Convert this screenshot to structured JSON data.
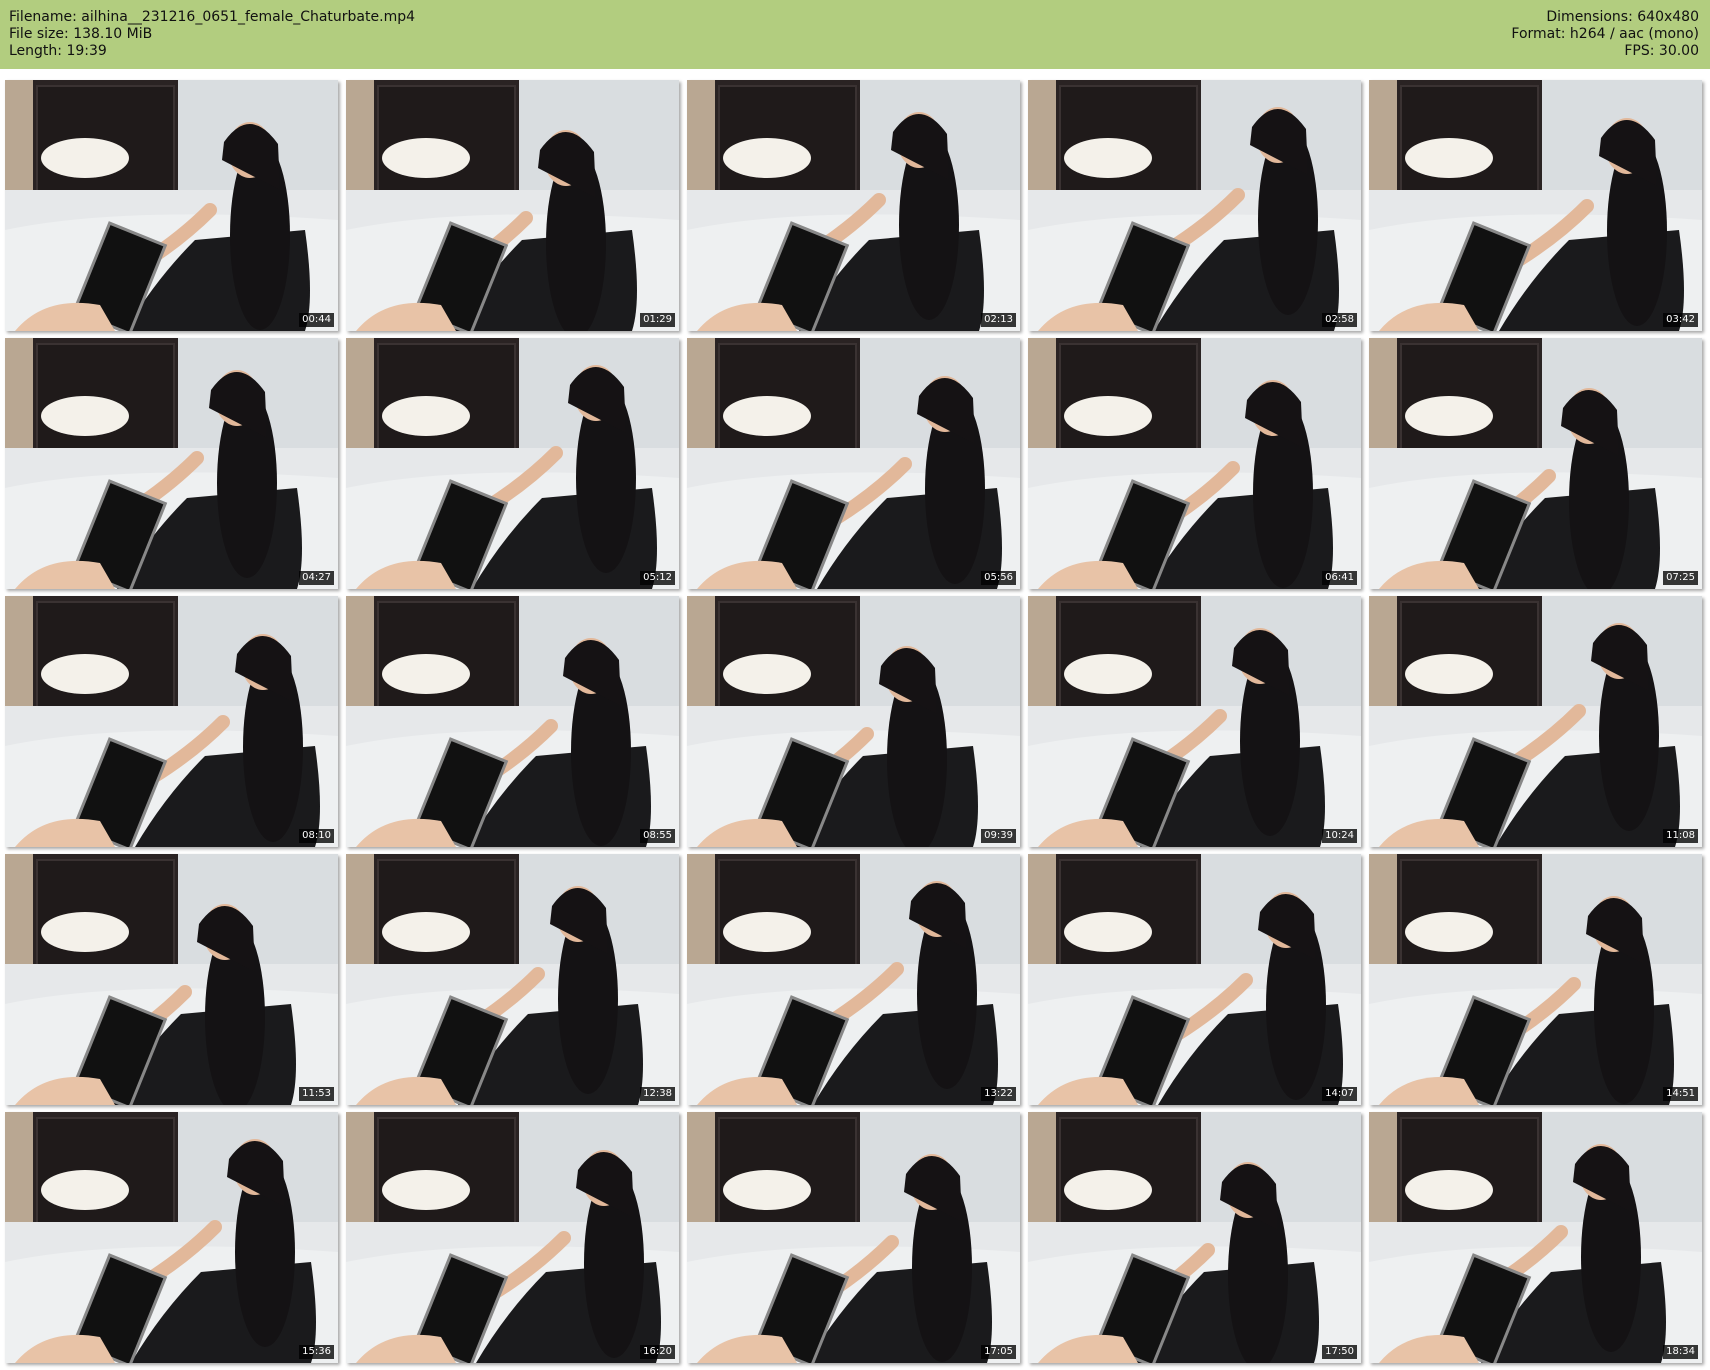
{
  "header": {
    "filename": "Filename: ailhina__231216_0651_female_Chaturbate.mp4",
    "file_size": "File size: 138.10 MiB",
    "length": "Length: 19:39",
    "dimensions": "Dimensions: 640x480",
    "format": "Format: h264 / aac (mono)",
    "fps": "FPS: 30.00",
    "background_color": "#b2cd7f"
  },
  "thumbnails": [
    {
      "timestamp": "00:44"
    },
    {
      "timestamp": "01:29"
    },
    {
      "timestamp": "02:13"
    },
    {
      "timestamp": "02:58"
    },
    {
      "timestamp": "03:42"
    },
    {
      "timestamp": "04:27"
    },
    {
      "timestamp": "05:12"
    },
    {
      "timestamp": "05:56"
    },
    {
      "timestamp": "06:41"
    },
    {
      "timestamp": "07:25"
    },
    {
      "timestamp": "08:10"
    },
    {
      "timestamp": "08:55"
    },
    {
      "timestamp": "09:39"
    },
    {
      "timestamp": "10:24"
    },
    {
      "timestamp": "11:08"
    },
    {
      "timestamp": "11:53"
    },
    {
      "timestamp": "12:38"
    },
    {
      "timestamp": "13:22"
    },
    {
      "timestamp": "14:07"
    },
    {
      "timestamp": "14:51"
    },
    {
      "timestamp": "15:36"
    },
    {
      "timestamp": "16:20"
    },
    {
      "timestamp": "17:05"
    },
    {
      "timestamp": "17:50"
    },
    {
      "timestamp": "18:34"
    }
  ]
}
